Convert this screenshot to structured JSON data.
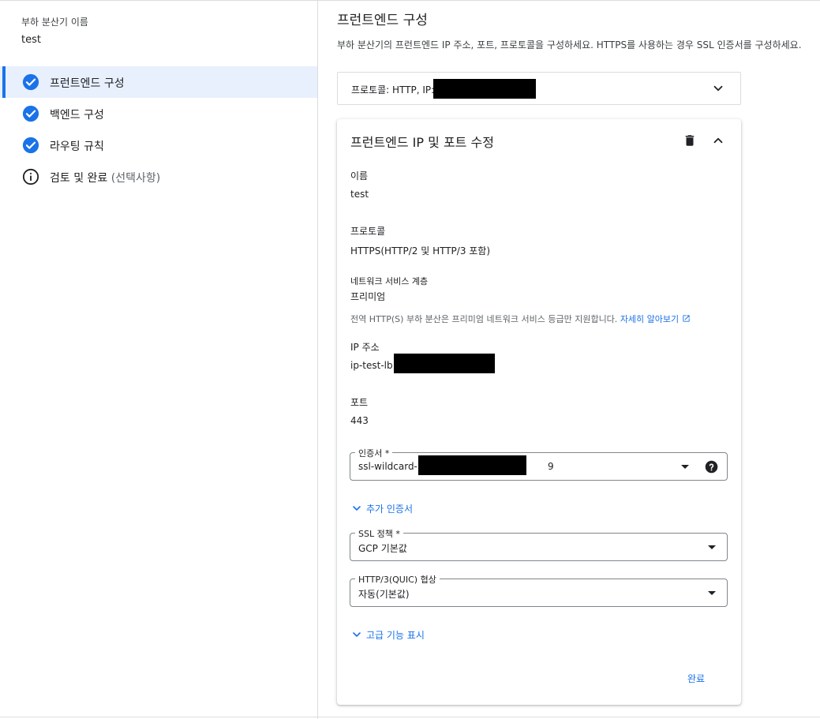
{
  "sidebar": {
    "lb_name_label": "부하 분산기 이름",
    "lb_name_value": "test",
    "steps": [
      {
        "label": "프런트엔드 구성",
        "status": "complete",
        "active": true
      },
      {
        "label": "백엔드 구성",
        "status": "complete",
        "active": false
      },
      {
        "label": "라우팅 규칙",
        "status": "complete",
        "active": false
      },
      {
        "label": "검토 및 완료",
        "optional": "(선택사항)",
        "status": "info",
        "active": false
      }
    ]
  },
  "main": {
    "title": "프런트엔드 구성",
    "description": "부하 분산기의 프런트엔드 IP 주소, 포트, 프로토콜을 구성하세요. HTTPS를 사용하는 경우 SSL 인증서를 구성하세요.",
    "collapsed_frontend": {
      "summary": "프로토콜: HTTP, IP:"
    },
    "card": {
      "title": "프런트엔드 IP 및 포트 수정",
      "name_label": "이름",
      "name_value": "test",
      "protocol_label": "프로토콜",
      "protocol_value": "HTTPS(HTTP/2 및 HTTP/3 포함)",
      "tier_label": "네트워크 서비스 계층",
      "tier_value": "프리미엄",
      "tier_hint": "전역 HTTP(S) 부하 분산은 프리미엄 네트워크 서비스 등급만 지원합니다.",
      "learn_more": "자세히 알아보기",
      "ip_label": "IP 주소",
      "ip_value": "ip-test-lb",
      "port_label": "포트",
      "port_value": "443",
      "cert_label": "인증서 *",
      "cert_value": "ssl-wildcard-",
      "cert_value_tail": "9",
      "add_cert": "추가 인증서",
      "ssl_policy_label": "SSL 정책 *",
      "ssl_policy_value": "GCP 기본값",
      "quic_label": "HTTP/3(QUIC) 협상",
      "quic_value": "자동(기본값)",
      "advanced": "고급 기능 표시",
      "done": "완료"
    }
  },
  "colors": {
    "accent": "#1a73e8",
    "active_bg": "#e8f0fe",
    "border": "#dadce0"
  },
  "icons": {
    "step_complete": "check-circle-icon",
    "step_info": "info-circle-icon",
    "expand": "chevron-down-icon",
    "collapse": "chevron-up-icon",
    "delete": "trash-icon",
    "help": "help-circle-icon",
    "external": "external-link-icon"
  }
}
